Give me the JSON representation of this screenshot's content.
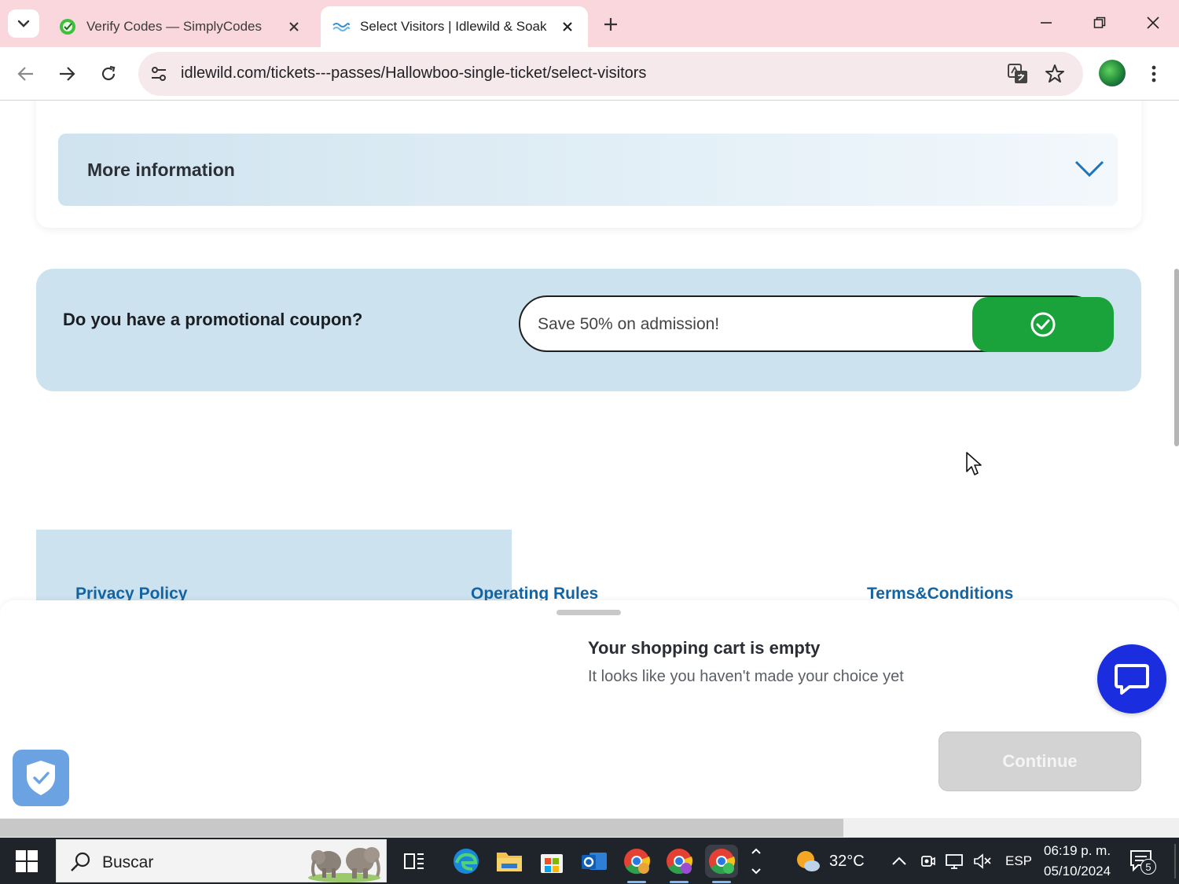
{
  "browser": {
    "tabs": [
      {
        "title": "Verify Codes — SimplyCodes",
        "active": false,
        "favicon": "simplycodes-favicon"
      },
      {
        "title": "Select Visitors | Idlewild & Soak",
        "active": true,
        "favicon": "idlewild-favicon"
      }
    ],
    "url": "idlewild.com/tickets---passes/Hallowboo-single-ticket/select-visitors"
  },
  "page": {
    "more_info_label": "More information",
    "promo": {
      "question": "Do you have a promotional coupon?",
      "input_value": "Save 50% on admission!",
      "apply_icon": "check-circle-icon"
    },
    "footer_links": [
      "Privacy Policy",
      "Operating Rules",
      "Terms&Conditions"
    ],
    "cart": {
      "title": "Your shopping cart is empty",
      "subtitle": "It looks like you haven't made your choice yet"
    },
    "continue_label": "Continue"
  },
  "taskbar": {
    "search_text": "Buscar",
    "weather": "32°C",
    "language": "ESP",
    "time": "06:19 p. m.",
    "date": "05/10/2024",
    "notification_count": "5"
  },
  "colors": {
    "tabbar_bg": "#f9d7dc",
    "promo_bg": "#cce3ef",
    "apply_green": "#1aa23b",
    "chat_blue": "#1a2ee0",
    "link_blue": "#1464a3"
  }
}
